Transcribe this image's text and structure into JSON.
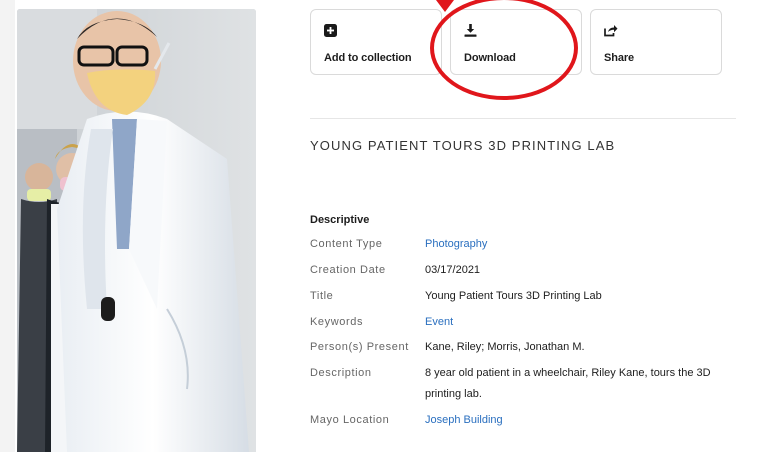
{
  "actions": {
    "add_to_collection": "Add to collection",
    "download": "Download",
    "share": "Share"
  },
  "asset": {
    "title": "YOUNG PATIENT TOURS 3D PRINTING LAB"
  },
  "details": {
    "section_label": "Descriptive",
    "rows": [
      {
        "key": "Content Type",
        "value": "Photography",
        "is_link": true
      },
      {
        "key": "Creation Date",
        "value": "03/17/2021",
        "is_link": false
      },
      {
        "key": "Title",
        "value": "Young Patient Tours 3D Printing Lab",
        "is_link": false
      },
      {
        "key": "Keywords",
        "value": "Event",
        "is_link": true
      },
      {
        "key": "Person(s) Present",
        "value": "Kane, Riley; Morris, Jonathan M.",
        "is_link": false
      },
      {
        "key": "Description",
        "value": "8 year old patient in a wheelchair, Riley Kane, tours the 3D printing lab.",
        "is_link": false
      },
      {
        "key": "Mayo Location",
        "value": "Joseph Building",
        "is_link": true
      }
    ]
  },
  "colors": {
    "link": "#2a6fbf",
    "highlight": "#e0161b",
    "border": "#dadada"
  },
  "icons": {
    "add_to_collection": "plus-square-icon",
    "download": "download-icon",
    "share": "share-icon"
  }
}
